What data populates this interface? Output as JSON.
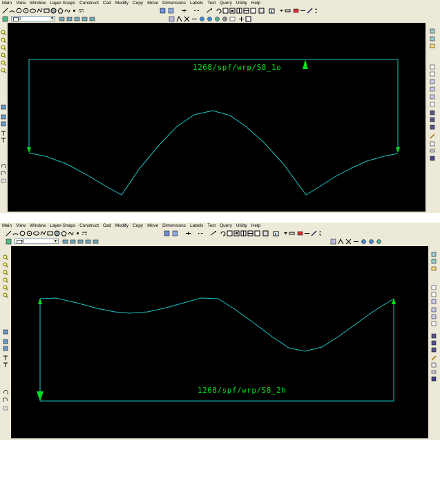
{
  "menu": [
    "Main",
    "View",
    "Window",
    "Layer-Snaps",
    "Construct",
    "Cad",
    "Modify",
    "Copy",
    "Move",
    "Dimensions",
    "Labels",
    "Text",
    "Query",
    "Utility",
    "Help"
  ],
  "layer_value": "0",
  "view1": {
    "label": "1268/spf/wrp/S8_1o"
  },
  "view2": {
    "label": "1268/spf/wrp/S8_2h"
  },
  "colors": {
    "curve": "#1ec4c4",
    "arrow": "#00e020",
    "canvas": "#000000",
    "chrome": "#ece9d8"
  }
}
